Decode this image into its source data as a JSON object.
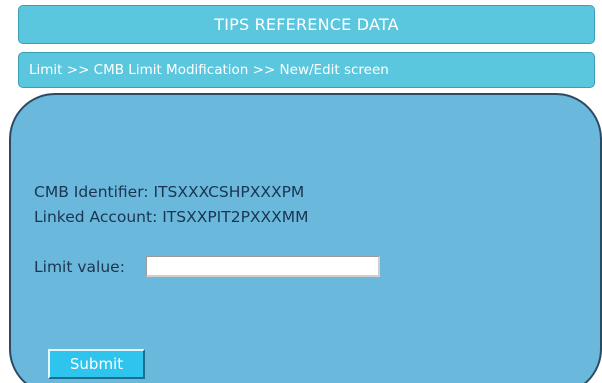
{
  "header": {
    "title": "TIPS REFERENCE DATA"
  },
  "breadcrumb": {
    "text": "Limit >> CMB Limit Modification >> New/Edit screen"
  },
  "form": {
    "cmb_identifier": "CMB Identifier: ITSXXXCSHPXXXPM",
    "linked_account": "Linked Account: ITSXXPIT2PXXXMM",
    "limit_label": "Limit value:",
    "limit_value": "",
    "submit_label": "Submit"
  },
  "colors": {
    "bar_background": "#5bc7de",
    "panel_background": "#6ab8dc",
    "panel_border": "#2d4a63",
    "button_background": "#2ec4ee",
    "text_dark": "#1b3550",
    "text_light": "#ffffff"
  }
}
